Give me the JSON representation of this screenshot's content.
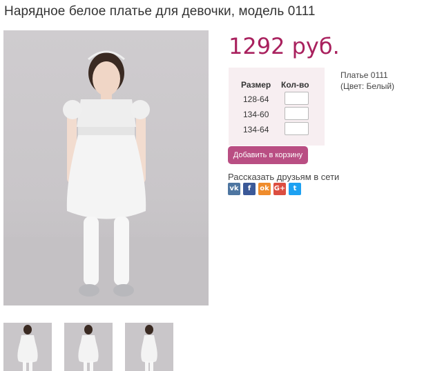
{
  "product": {
    "title": "Нарядное белое платье для девочки, модель 0111",
    "price": "1292 руб.",
    "note_line1": "Платье 0111",
    "note_line2": "(Цвет: Белый)"
  },
  "sizes": {
    "col_size": "Размер",
    "col_qty": "Кол-во",
    "rows": [
      {
        "size": "128-64",
        "qty": ""
      },
      {
        "size": "134-60",
        "qty": ""
      },
      {
        "size": "134-64",
        "qty": ""
      }
    ]
  },
  "cart": {
    "add_label": "Добавить в корзину"
  },
  "share": {
    "label": "Рассказать друзьям в сети",
    "icons": [
      {
        "name": "vk-icon",
        "glyph": "vk",
        "color": "#4e76a1"
      },
      {
        "name": "facebook-icon",
        "glyph": "f",
        "color": "#3b5998"
      },
      {
        "name": "odnoklassniki-icon",
        "glyph": "ok",
        "color": "#ef8c2c"
      },
      {
        "name": "google-plus-icon",
        "glyph": "G+",
        "color": "#dc4e41"
      },
      {
        "name": "twitter-icon",
        "glyph": "t",
        "color": "#1da1f2"
      }
    ]
  },
  "colors": {
    "price": "#a9215e",
    "button": "#b94e83",
    "size_box_bg": "#f7eef1"
  }
}
